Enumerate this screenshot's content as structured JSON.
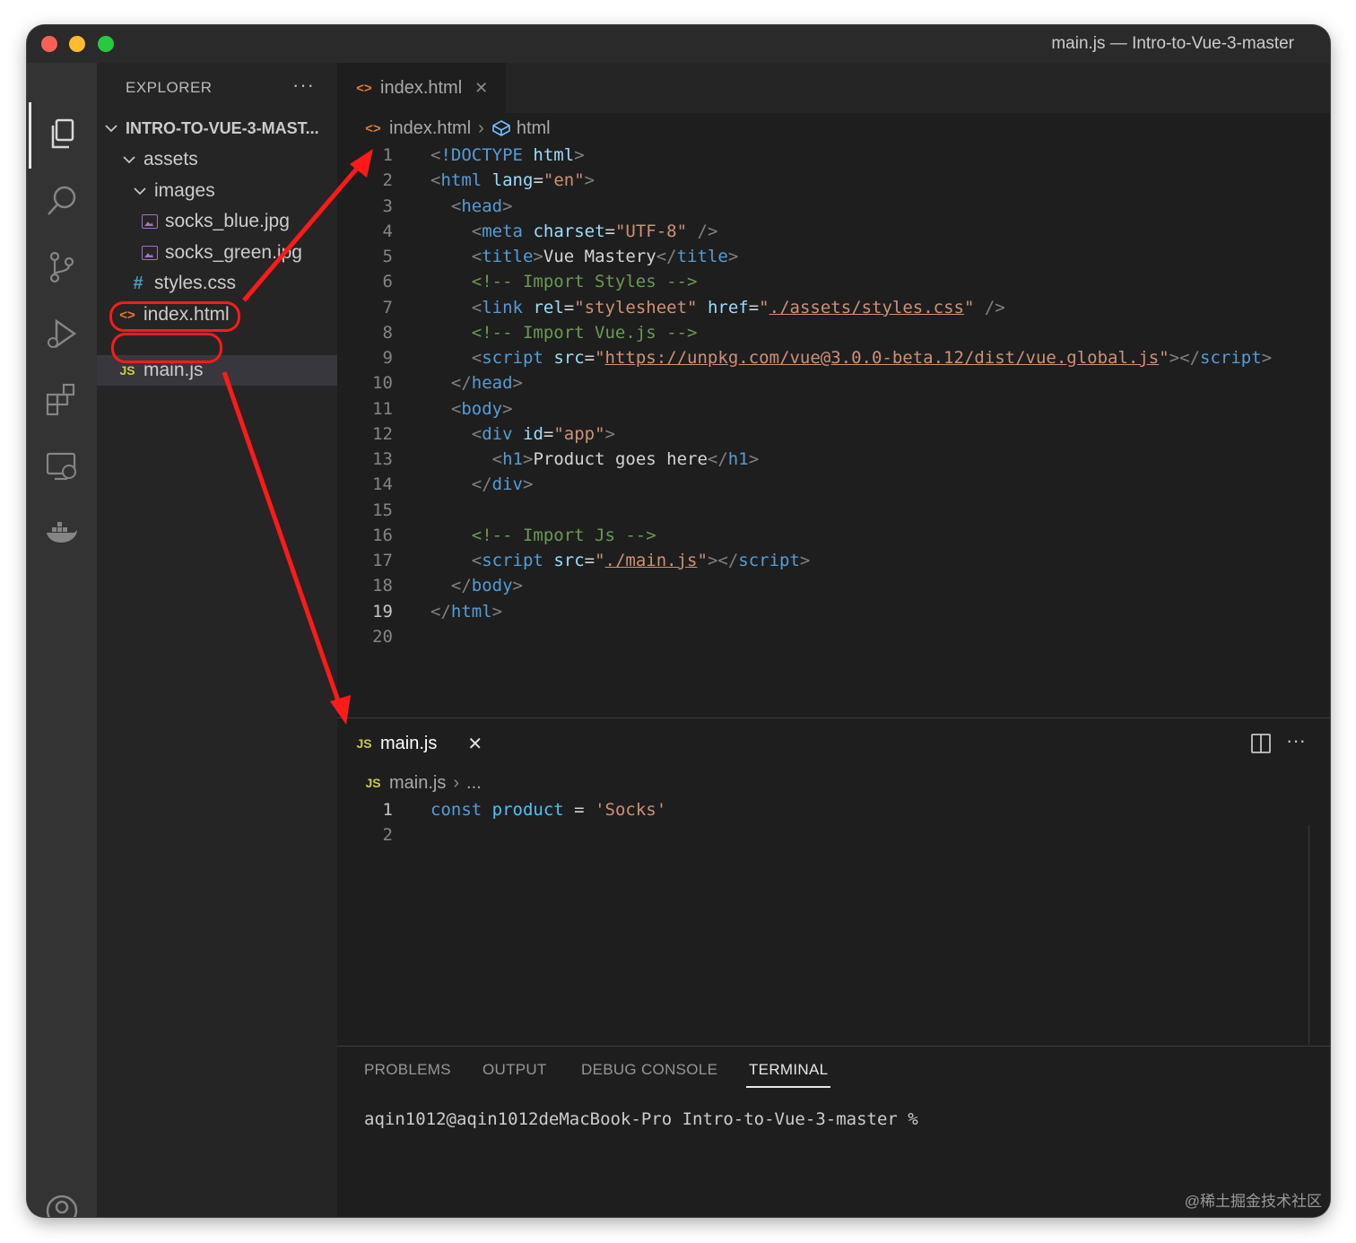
{
  "window": {
    "title": "main.js — Intro-to-Vue-3-master"
  },
  "explorer": {
    "header": "EXPLORER",
    "more": "···",
    "root": "INTRO-TO-VUE-3-MAST...",
    "tree": [
      {
        "label": "assets",
        "type": "folder"
      },
      {
        "label": "images",
        "type": "folder"
      },
      {
        "label": "socks_blue.jpg",
        "type": "image"
      },
      {
        "label": "socks_green.jpg",
        "type": "image"
      },
      {
        "label": "styles.css",
        "type": "css",
        "icon": "#"
      },
      {
        "label": "index.html",
        "type": "html",
        "icon": "<>"
      },
      {
        "label": "main.js",
        "type": "js",
        "icon": "JS"
      }
    ]
  },
  "editor_top": {
    "tab_label": "index.html",
    "tab_icon": "<>",
    "breadcrumb": [
      "index.html",
      "html"
    ],
    "line_numbers": [
      "1",
      "2",
      "3",
      "4",
      "5",
      "6",
      "7",
      "8",
      "9",
      "10",
      "11",
      "12",
      "13",
      "14",
      "15",
      "16",
      "17",
      "18",
      "19",
      "20"
    ],
    "current_line": "19",
    "lines": [
      [
        [
          "t-punc",
          "<"
        ],
        [
          "t-tag",
          "!DOCTYPE"
        ],
        [
          "t-txt",
          " "
        ],
        [
          "t-attr",
          "html"
        ],
        [
          "t-punc",
          ">"
        ]
      ],
      [
        [
          "t-punc",
          "<"
        ],
        [
          "t-tag",
          "html"
        ],
        [
          "t-txt",
          " "
        ],
        [
          "t-attr",
          "lang"
        ],
        [
          "t-txt",
          "="
        ],
        [
          "t-str",
          "\"en\""
        ],
        [
          "t-punc",
          ">"
        ]
      ],
      [
        [
          "t-txt",
          "  "
        ],
        [
          "t-punc",
          "<"
        ],
        [
          "t-tag",
          "head"
        ],
        [
          "t-punc",
          ">"
        ]
      ],
      [
        [
          "t-txt",
          "    "
        ],
        [
          "t-punc",
          "<"
        ],
        [
          "t-tag",
          "meta"
        ],
        [
          "t-txt",
          " "
        ],
        [
          "t-attr",
          "charset"
        ],
        [
          "t-txt",
          "="
        ],
        [
          "t-str",
          "\"UTF-8\""
        ],
        [
          "t-txt",
          " "
        ],
        [
          "t-punc",
          "/>"
        ]
      ],
      [
        [
          "t-txt",
          "    "
        ],
        [
          "t-punc",
          "<"
        ],
        [
          "t-tag",
          "title"
        ],
        [
          "t-punc",
          ">"
        ],
        [
          "t-txt",
          "Vue Mastery"
        ],
        [
          "t-punc",
          "</"
        ],
        [
          "t-tag",
          "title"
        ],
        [
          "t-punc",
          ">"
        ]
      ],
      [
        [
          "t-txt",
          "    "
        ],
        [
          "t-com",
          "<!-- Import Styles -->"
        ]
      ],
      [
        [
          "t-txt",
          "    "
        ],
        [
          "t-punc",
          "<"
        ],
        [
          "t-tag",
          "link"
        ],
        [
          "t-txt",
          " "
        ],
        [
          "t-attr",
          "rel"
        ],
        [
          "t-txt",
          "="
        ],
        [
          "t-str",
          "\"stylesheet\""
        ],
        [
          "t-txt",
          " "
        ],
        [
          "t-attr",
          "href"
        ],
        [
          "t-txt",
          "="
        ],
        [
          "t-str",
          "\""
        ],
        [
          "t-link",
          "./assets/styles.css"
        ],
        [
          "t-str",
          "\""
        ],
        [
          "t-txt",
          " "
        ],
        [
          "t-punc",
          "/>"
        ]
      ],
      [
        [
          "t-txt",
          "    "
        ],
        [
          "t-com",
          "<!-- Import Vue.js -->"
        ]
      ],
      [
        [
          "t-txt",
          "    "
        ],
        [
          "t-punc",
          "<"
        ],
        [
          "t-tag",
          "script"
        ],
        [
          "t-txt",
          " "
        ],
        [
          "t-attr",
          "src"
        ],
        [
          "t-txt",
          "="
        ],
        [
          "t-str",
          "\""
        ],
        [
          "t-link",
          "https://unpkg.com/vue@3.0.0-beta.12/dist/vue.global.js"
        ],
        [
          "t-str",
          "\""
        ],
        [
          "t-punc",
          "></"
        ],
        [
          "t-tag",
          "script"
        ],
        [
          "t-punc",
          ">"
        ]
      ],
      [
        [
          "t-txt",
          "  "
        ],
        [
          "t-punc",
          "</"
        ],
        [
          "t-tag",
          "head"
        ],
        [
          "t-punc",
          ">"
        ]
      ],
      [
        [
          "t-txt",
          "  "
        ],
        [
          "t-punc",
          "<"
        ],
        [
          "t-tag",
          "body"
        ],
        [
          "t-punc",
          ">"
        ]
      ],
      [
        [
          "t-txt",
          "    "
        ],
        [
          "t-punc",
          "<"
        ],
        [
          "t-tag",
          "div"
        ],
        [
          "t-txt",
          " "
        ],
        [
          "t-attr",
          "id"
        ],
        [
          "t-txt",
          "="
        ],
        [
          "t-str",
          "\"app\""
        ],
        [
          "t-punc",
          ">"
        ]
      ],
      [
        [
          "t-txt",
          "      "
        ],
        [
          "t-punc",
          "<"
        ],
        [
          "t-tag",
          "h1"
        ],
        [
          "t-punc",
          ">"
        ],
        [
          "t-txt",
          "Product goes here"
        ],
        [
          "t-punc",
          "</"
        ],
        [
          "t-tag",
          "h1"
        ],
        [
          "t-punc",
          ">"
        ]
      ],
      [
        [
          "t-txt",
          "    "
        ],
        [
          "t-punc",
          "</"
        ],
        [
          "t-tag",
          "div"
        ],
        [
          "t-punc",
          ">"
        ]
      ],
      [
        [
          "t-txt",
          ""
        ]
      ],
      [
        [
          "t-txt",
          "    "
        ],
        [
          "t-com",
          "<!-- Import Js -->"
        ]
      ],
      [
        [
          "t-txt",
          "    "
        ],
        [
          "t-punc",
          "<"
        ],
        [
          "t-tag",
          "script"
        ],
        [
          "t-txt",
          " "
        ],
        [
          "t-attr",
          "src"
        ],
        [
          "t-txt",
          "="
        ],
        [
          "t-str",
          "\""
        ],
        [
          "t-link",
          "./main.js"
        ],
        [
          "t-str",
          "\""
        ],
        [
          "t-punc",
          "></"
        ],
        [
          "t-tag",
          "script"
        ],
        [
          "t-punc",
          ">"
        ]
      ],
      [
        [
          "t-txt",
          "  "
        ],
        [
          "t-punc",
          "</"
        ],
        [
          "t-tag",
          "body"
        ],
        [
          "t-punc",
          ">"
        ]
      ],
      [
        [
          "t-punc",
          "</"
        ],
        [
          "t-tag",
          "html"
        ],
        [
          "t-punc",
          ">"
        ]
      ],
      [
        [
          "t-txt",
          ""
        ]
      ]
    ]
  },
  "editor_bottom": {
    "tab_label": "main.js",
    "tab_icon": "JS",
    "tab_close": "✕",
    "breadcrumb": [
      "main.js",
      "..."
    ],
    "line_numbers": [
      "1",
      "2"
    ],
    "current_line": "1",
    "lines": [
      [
        [
          "t-kw",
          "const"
        ],
        [
          "t-txt",
          " "
        ],
        [
          "t-var",
          "product"
        ],
        [
          "t-txt",
          " = "
        ],
        [
          "t-str",
          "'Socks'"
        ]
      ],
      [
        [
          "t-txt",
          ""
        ]
      ]
    ]
  },
  "panel": {
    "tabs": [
      "PROBLEMS",
      "OUTPUT",
      "DEBUG CONSOLE",
      "TERMINAL"
    ],
    "active": "TERMINAL",
    "terminal_prompt": "aqin1012@aqin1012deMacBook-Pro Intro-to-Vue-3-master %"
  },
  "watermark": "@稀土掘金技术社区",
  "colors": {
    "annotation": "#ff1a1a",
    "background": "#1e1e1e"
  }
}
